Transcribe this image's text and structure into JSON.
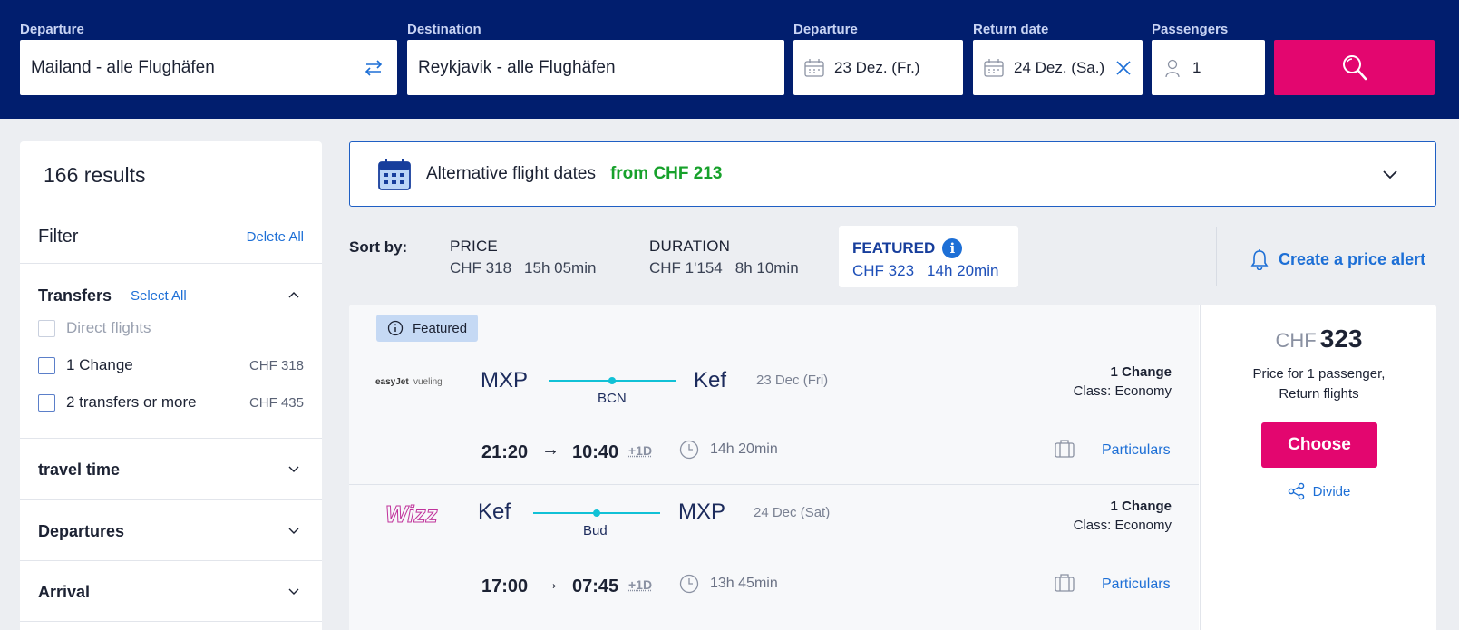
{
  "search": {
    "departure_label": "Departure",
    "departure_value": "Mailand - alle Flughäfen",
    "destination_label": "Destination",
    "destination_value": "Reykjavik - alle Flughäfen",
    "depart_date_label": "Departure",
    "depart_date_value": "23 Dez. (Fr.)",
    "return_date_label": "Return date",
    "return_date_value": "24 Dez. (Sa.)",
    "passengers_label": "Passengers",
    "passengers_value": "1"
  },
  "sidebar": {
    "results_count": "166 results",
    "filter_title": "Filter",
    "delete_all": "Delete All",
    "transfers": {
      "title": "Transfers",
      "select_all": "Select All",
      "options": [
        {
          "label": "Direct flights",
          "price": "",
          "disabled": true
        },
        {
          "label": "1 Change",
          "price": "CHF 318",
          "disabled": false
        },
        {
          "label": "2 transfers or more",
          "price": "CHF 435",
          "disabled": false
        }
      ]
    },
    "sections": [
      "travel time",
      "Departures",
      "Arrival"
    ]
  },
  "alt_dates": {
    "label": "Alternative flight dates",
    "from": "from CHF 213"
  },
  "sort": {
    "label": "Sort by:",
    "price": {
      "name": "PRICE",
      "amount": "CHF 318",
      "duration": "15h 05min"
    },
    "duration": {
      "name": "DURATION",
      "amount": "CHF 1'154",
      "duration": "8h 10min"
    },
    "featured": {
      "name": "FEATURED",
      "amount": "CHF 323",
      "duration": "14h 20min"
    },
    "price_alert": "Create a price alert"
  },
  "result": {
    "badge": "Featured",
    "outbound": {
      "airlines": [
        "easyJet",
        "vueling"
      ],
      "from": "MXP",
      "to": "Kef",
      "via": "BCN",
      "date": "23 Dec (Fri)",
      "changes": "1 Change",
      "class": "Class: Economy",
      "depart_time": "21:20",
      "arrive_time": "10:40",
      "plus_day": "+1D",
      "duration": "14h 20min",
      "details": "Particulars"
    },
    "inbound": {
      "airline": "Wizz",
      "from": "Kef",
      "to": "MXP",
      "via": "Bud",
      "date": "24 Dec (Sat)",
      "changes": "1 Change",
      "class": "Class: Economy",
      "depart_time": "17:00",
      "arrive_time": "07:45",
      "plus_day": "+1D",
      "duration": "13h 45min",
      "details": "Particulars"
    },
    "currency": "CHF",
    "price": "323",
    "price_note_1": "Price for 1 passenger,",
    "price_note_2": "Return flights",
    "choose": "Choose",
    "divide": "Divide"
  },
  "colors": {
    "header_bg": "#011e6e",
    "accent_pink": "#e3066f",
    "link_blue": "#1d6fd6",
    "price_green": "#17a12b",
    "route_cyan": "#11c1d6"
  }
}
